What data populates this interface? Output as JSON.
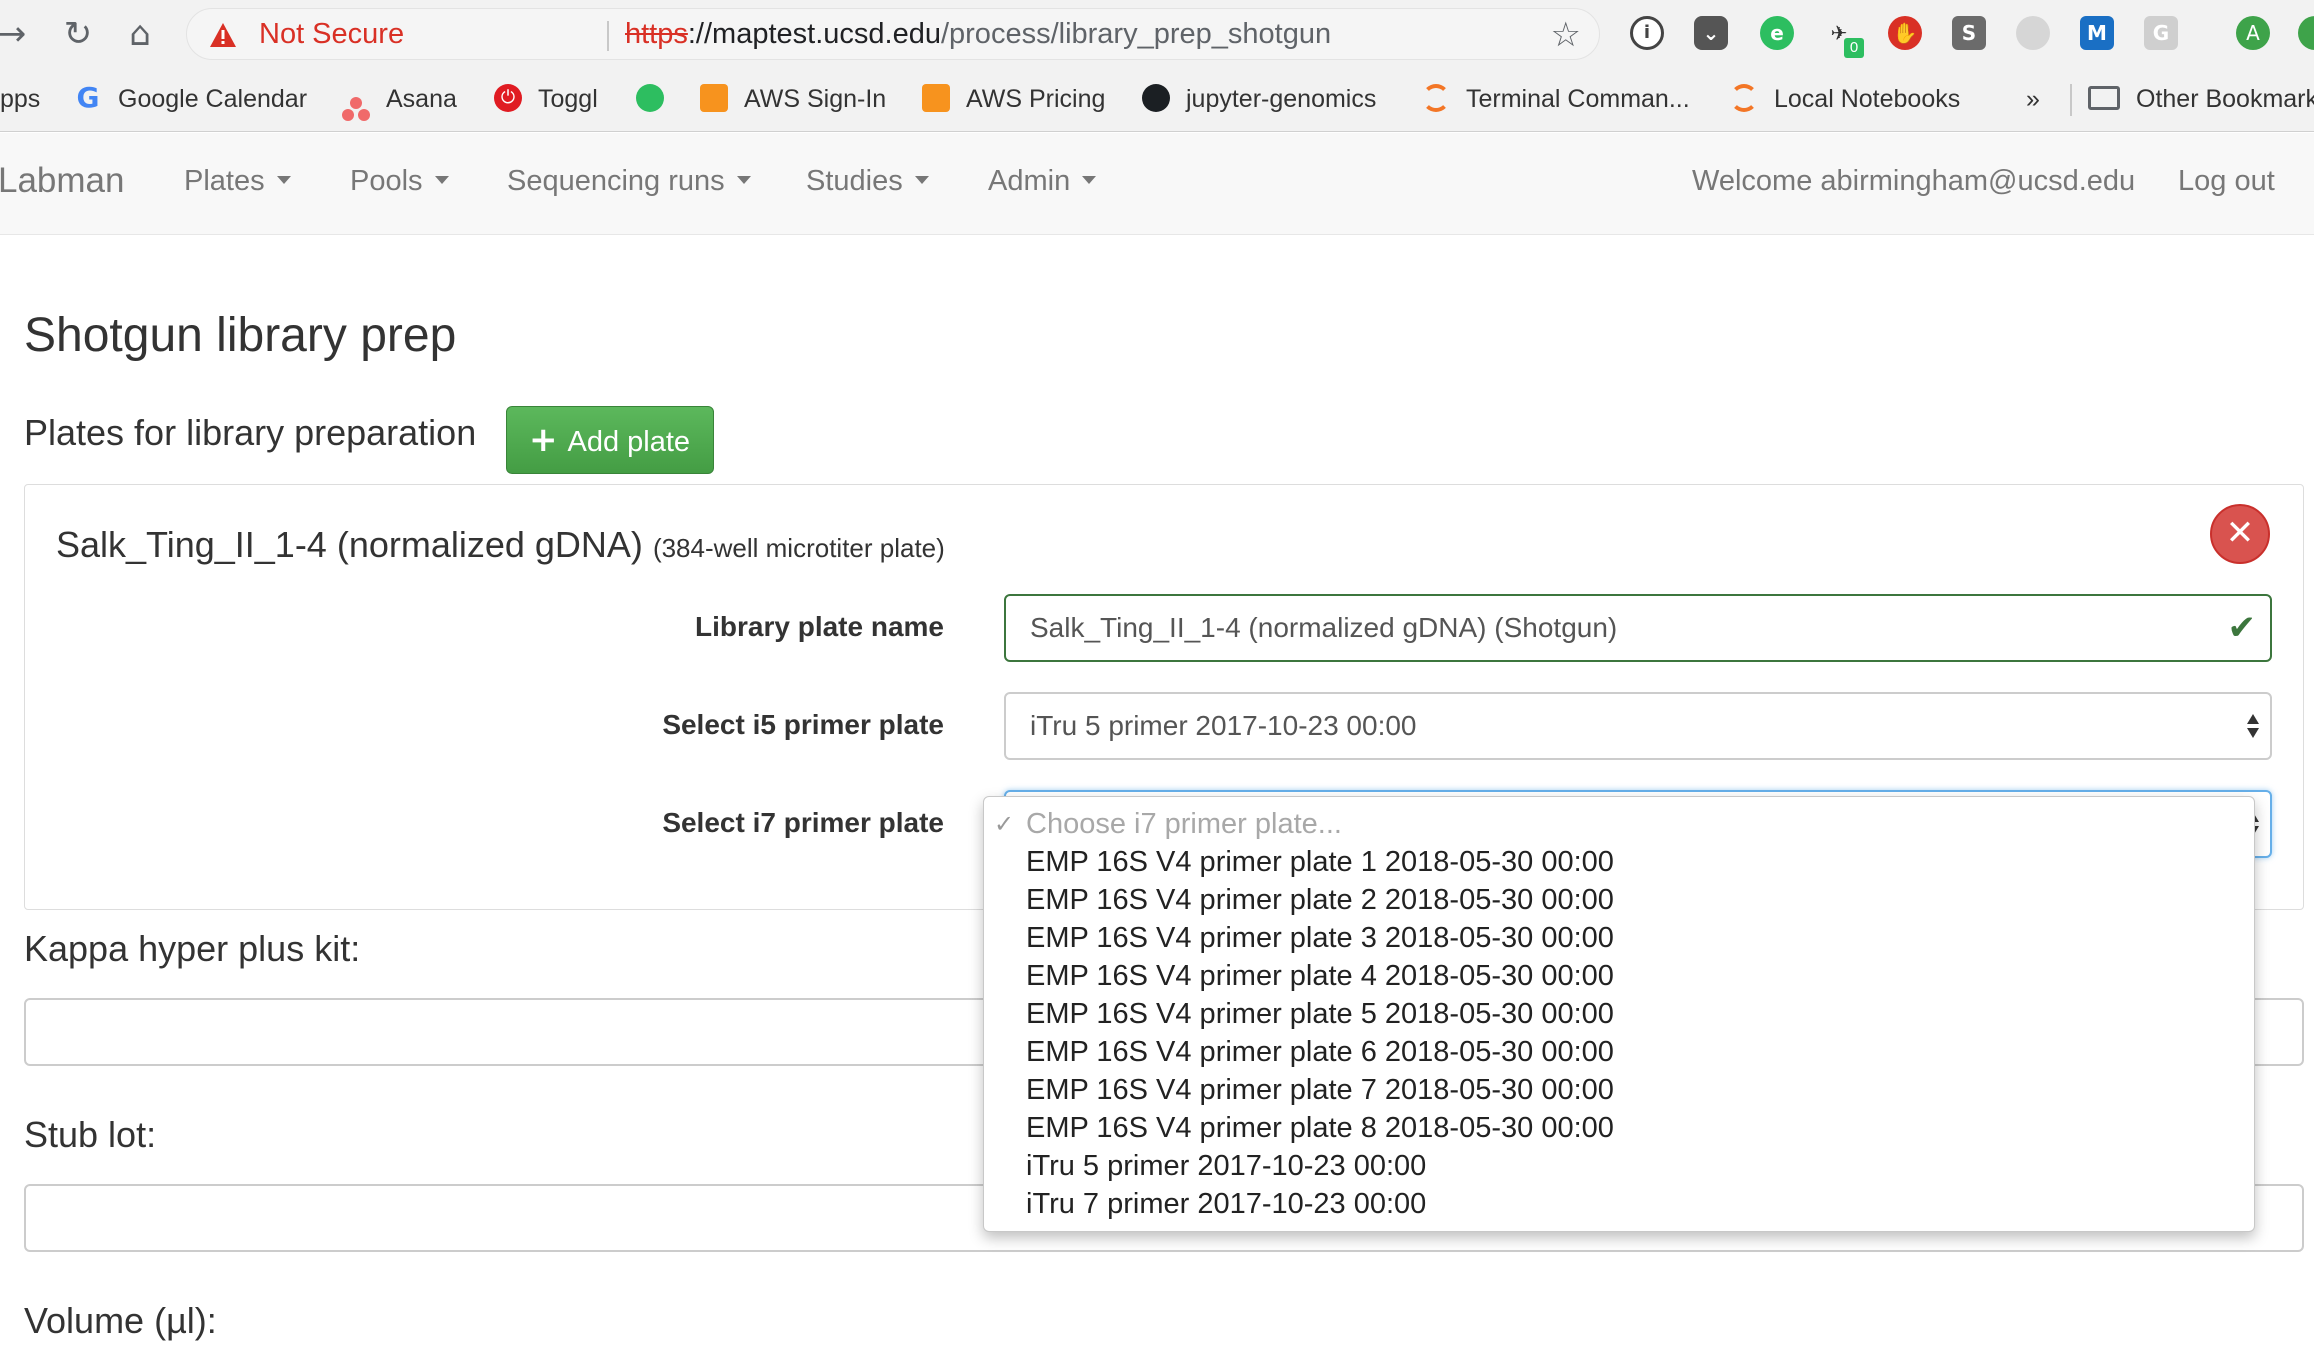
{
  "browser": {
    "security_label": "Not Secure",
    "url_scheme": "https",
    "url_rest": "://",
    "url_host": "maptest.ucsd.edu",
    "url_path": "/process/library_prep_shotgun",
    "extension_badge": "0",
    "profile_initial": "A"
  },
  "bookmarks": {
    "apps": "pps",
    "items": [
      {
        "label": "Google Calendar",
        "icon": "google-icon"
      },
      {
        "label": "Asana",
        "icon": "asana-icon"
      },
      {
        "label": "Toggl",
        "icon": "toggl-icon"
      },
      {
        "label": "",
        "icon": "evernote-icon"
      },
      {
        "label": "AWS Sign-In",
        "icon": "aws-icon"
      },
      {
        "label": "AWS Pricing",
        "icon": "aws-icon"
      },
      {
        "label": "jupyter-genomics",
        "icon": "github-icon"
      },
      {
        "label": "Terminal Comman...",
        "icon": "jupyter-icon"
      },
      {
        "label": "Local Notebooks",
        "icon": "jupyter-icon"
      }
    ],
    "overflow": "»",
    "other": "Other Bookmark"
  },
  "navbar": {
    "brand": "Labman",
    "menus": [
      "Plates",
      "Pools",
      "Sequencing runs",
      "Studies",
      "Admin"
    ],
    "welcome": "Welcome abirmingham@ucsd.edu",
    "logout": "Log out"
  },
  "page": {
    "title": "Shotgun library prep",
    "plates_section": "Plates for library preparation",
    "add_plate": "Add plate"
  },
  "plate": {
    "name": "Salk_Ting_II_1-4 (normalized gDNA)",
    "type": "(384-well microtiter plate)",
    "library_label": "Library plate name",
    "library_value": "Salk_Ting_II_1-4 (normalized gDNA) (Shotgun)",
    "i5_label": "Select i5 primer plate",
    "i5_value": "iTru 5 primer 2017-10-23 00:00",
    "i7_label": "Select i7 primer plate"
  },
  "fields": {
    "kappa": "Kappa hyper plus kit:",
    "stub": "Stub lot:",
    "volume": "Volume (µl):"
  },
  "i7_dropdown": {
    "placeholder": "Choose i7 primer plate...",
    "options": [
      "EMP 16S V4 primer plate 1 2018-05-30 00:00",
      "EMP 16S V4 primer plate 2 2018-05-30 00:00",
      "EMP 16S V4 primer plate 3 2018-05-30 00:00",
      "EMP 16S V4 primer plate 4 2018-05-30 00:00",
      "EMP 16S V4 primer plate 5 2018-05-30 00:00",
      "EMP 16S V4 primer plate 6 2018-05-30 00:00",
      "EMP 16S V4 primer plate 7 2018-05-30 00:00",
      "EMP 16S V4 primer plate 8 2018-05-30 00:00",
      "iTru 5 primer 2017-10-23 00:00",
      "iTru 7 primer 2017-10-23 00:00"
    ]
  },
  "colors": {
    "success": "#5cb85c",
    "danger": "#d9534f",
    "valid_border": "#3c763d",
    "insecure": "#d93025"
  }
}
